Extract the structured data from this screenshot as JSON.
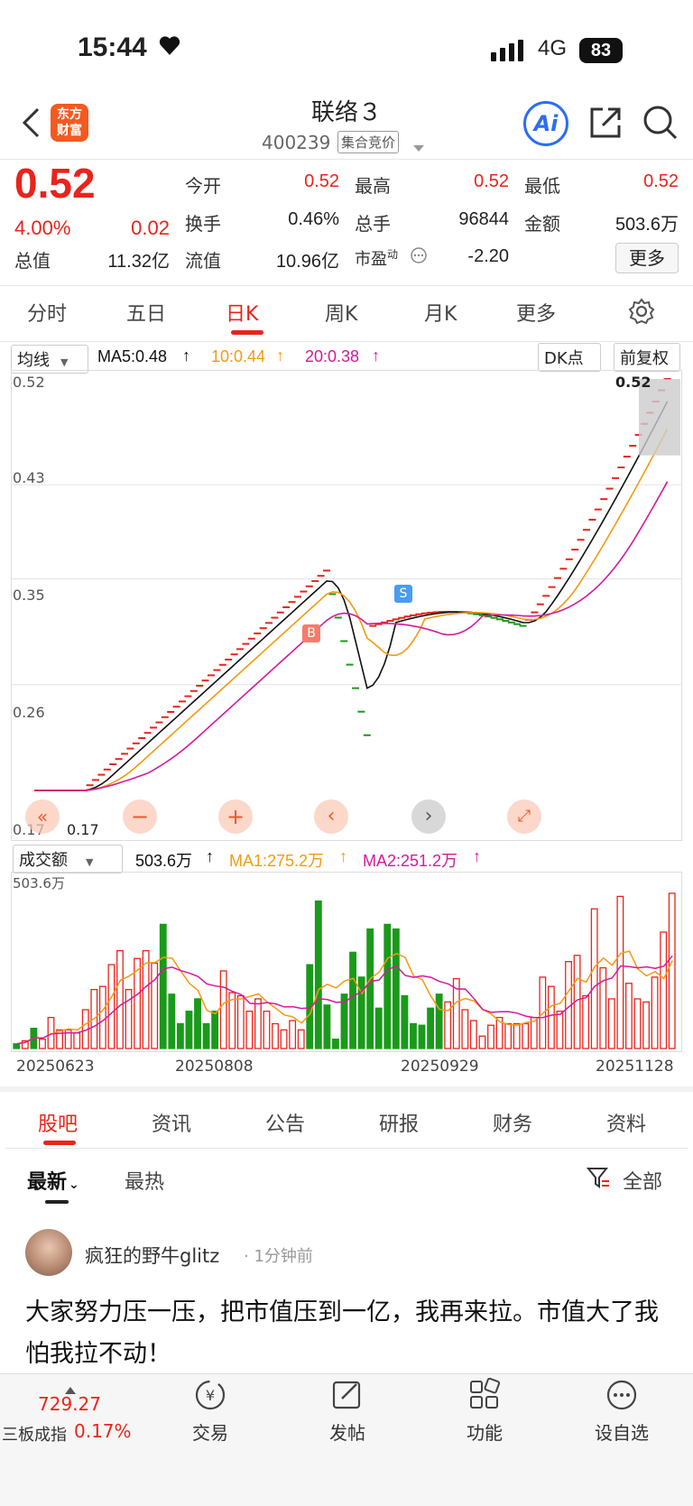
{
  "status": {
    "time": "15:44",
    "network": "4G",
    "battery": "83"
  },
  "header": {
    "logo": "东方\n财富",
    "name": "联络３",
    "code": "400239",
    "badge": "集合竞价",
    "ai": "Ai"
  },
  "quote": {
    "price": "0.52",
    "pct": "4.00%",
    "change": "0.02",
    "rows": [
      {
        "l1": "今开",
        "v1": "0.52",
        "l2": "最高",
        "v2": "0.52",
        "l3": "最低",
        "v3": "0.52"
      },
      {
        "l1": "换手",
        "v1": "0.46%",
        "l2": "总手",
        "v2": "96844",
        "l3": "金额",
        "v3": "503.6万"
      },
      {
        "l0": "总值",
        "v0": "11.32亿",
        "l1": "流值",
        "v1": "10.96亿",
        "l2": "市盈",
        "l2sup": "动",
        "v2": "-2.20"
      }
    ],
    "more": "更多"
  },
  "period_tabs": [
    "分时",
    "五日",
    "日K",
    "周K",
    "月K",
    "更多"
  ],
  "ma_bar": {
    "selector": "均线",
    "ma5": "MA5:0.48",
    "ma10": "10:0.44",
    "ma20": "20:0.38",
    "dk": "DK点",
    "adjust": "前复权"
  },
  "kline": {
    "y_ticks": [
      "0.52",
      "0.43",
      "0.35",
      "0.26",
      "0.17"
    ],
    "low_label": "0.17",
    "high_label": "0.52",
    "markers": {
      "buy": "B",
      "sell": "S"
    }
  },
  "volume_bar": {
    "selector": "成交额",
    "value": "503.6万",
    "ma1": "MA1:275.2万",
    "ma2": "MA2:251.2万",
    "max_label": "503.6万"
  },
  "x_dates": [
    "20250623",
    "20250808",
    "20250929",
    "20251128"
  ],
  "chart_data": {
    "type": "bar",
    "title": "",
    "ylabel": "成交额",
    "y_max_label": "503.6万",
    "categories_first_last": [
      "20250623",
      "20251128"
    ],
    "values_relative": [
      0.03,
      0.05,
      0.13,
      0.06,
      0.2,
      0.12,
      0.12,
      0.1,
      0.25,
      0.38,
      0.4,
      0.54,
      0.63,
      0.38,
      0.58,
      0.63,
      0.55,
      0.8,
      0.35,
      0.16,
      0.24,
      0.32,
      0.16,
      0.24,
      0.5,
      0.36,
      0.34,
      0.24,
      0.32,
      0.24,
      0.16,
      0.12,
      0.18,
      0.12,
      0.54,
      0.95,
      0.28,
      0.06,
      0.35,
      0.62,
      0.46,
      0.77,
      0.26,
      0.8,
      0.77,
      0.34,
      0.16,
      0.15,
      0.26,
      0.35,
      0.3,
      0.45,
      0.25,
      0.18,
      0.08,
      0.15,
      0.2,
      0.16,
      0.16,
      0.16,
      0.2,
      0.46,
      0.4,
      0.24,
      0.56,
      0.6,
      0.34,
      0.9,
      0.52,
      0.32,
      0.98,
      0.42,
      0.32,
      0.3,
      0.46,
      0.75,
      1.0
    ],
    "down_days": [
      0,
      2,
      17,
      18,
      19,
      20,
      21,
      22,
      23,
      34,
      35,
      36,
      37,
      38,
      39,
      40,
      41,
      42,
      43,
      44,
      45,
      46,
      47,
      48,
      49
    ],
    "unit": "万"
  },
  "bottom_tabs": [
    "股吧",
    "资讯",
    "公告",
    "研报",
    "财务",
    "资料"
  ],
  "sub_tabs": {
    "latest": "最新",
    "hot": "最热",
    "filter": "全部"
  },
  "post": {
    "user": "疯狂的野牛glitz",
    "time": "1分钟前",
    "body": "大家努力压一压，把市值压到一亿，我再来拉。市值大了我怕我拉不动！"
  },
  "bottom_nav": {
    "index_value": "729.27",
    "index_name": "三板成指",
    "index_pct": "0.17%",
    "trade": "交易",
    "post": "发帖",
    "func": "功能",
    "watch": "设自选"
  }
}
